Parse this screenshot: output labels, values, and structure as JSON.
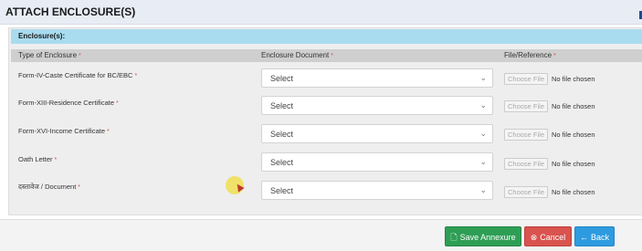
{
  "header": {
    "title": "ATTACH ENCLOSURE(S)"
  },
  "enclosures": {
    "title": "Enclosure(s):",
    "columns": {
      "type": "Type of Enclosure",
      "document": "Enclosure Document",
      "file": "File/Reference",
      "required_mark": "*"
    },
    "rows": [
      {
        "label": "Form-IV-Caste Certificate for BC/EBC",
        "select_value": "Select",
        "file_button": "Choose File",
        "file_status": "No file chosen"
      },
      {
        "label": "Form-XIII-Residence Certificate",
        "select_value": "Select",
        "file_button": "Choose File",
        "file_status": "No file chosen"
      },
      {
        "label": "Form-XVI-Income Certificate",
        "select_value": "Select",
        "file_button": "Choose File",
        "file_status": "No file chosen"
      },
      {
        "label": "Oath Letter",
        "select_value": "Select",
        "file_button": "Choose File",
        "file_status": "No file chosen"
      },
      {
        "label": "दस्तावेज / Document",
        "select_value": "Select",
        "file_button": "Choose File",
        "file_status": "No file chosen"
      }
    ]
  },
  "footer": {
    "save_label": "Save Annexure",
    "cancel_label": "Cancel",
    "back_label": "Back"
  },
  "icons": {
    "save": "file-icon",
    "cancel": "cancel-circle-icon",
    "back": "arrow-left-icon",
    "select_caret": "chevron-down-icon"
  },
  "colors": {
    "header_bg": "#e8edf5",
    "enclosure_strip": "#a9dcef",
    "save_button": "#2e9e55",
    "cancel_button": "#d9534f",
    "back_button": "#2e9be0",
    "required_mark": "#d9534f"
  }
}
